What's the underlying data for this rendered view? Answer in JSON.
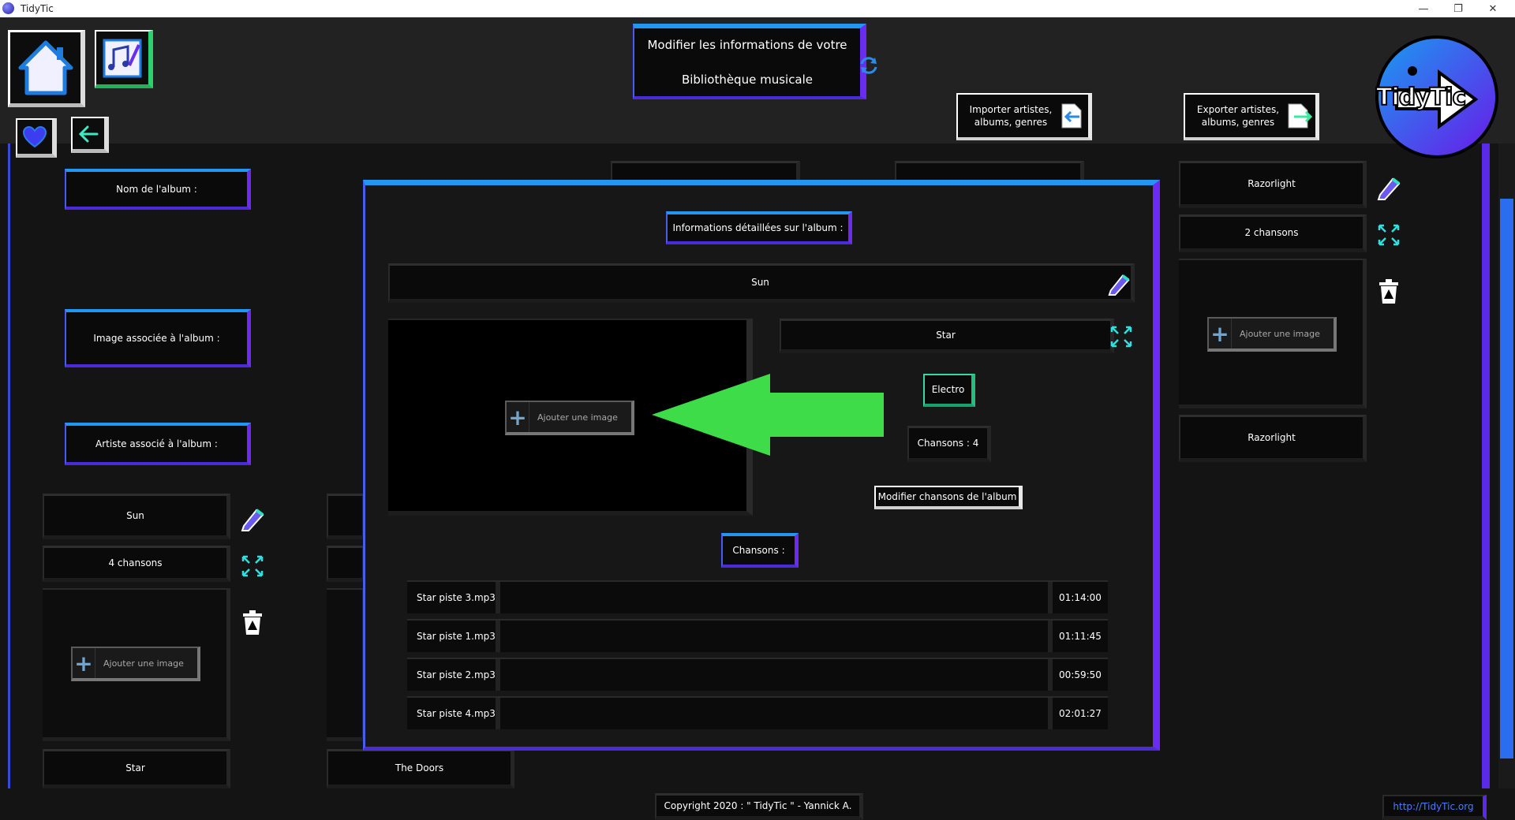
{
  "window": {
    "title": "TidyTic"
  },
  "header": {
    "title_line1": "Modifier les informations de votre",
    "title_line2": "Bibliothèque musicale",
    "import_label": "Importer artistes, albums, genres",
    "export_label": "Exporter artistes, albums, genres",
    "logo_text": "TidyTic"
  },
  "left_panel": {
    "album_name_label": "Nom de l'album :",
    "album_image_label": "Image associée à l'album :",
    "album_artist_label": "Artiste associé à l'album :",
    "card1_name": "Sun",
    "card1_count": "4 chansons",
    "card1_add_image": "Ajouter une image",
    "card1_artist": "Star",
    "card2_artist": "The Doors"
  },
  "right_panel": {
    "name": "Razorlight",
    "count": "2 chansons",
    "add_image": "Ajouter une image",
    "artist": "Razorlight"
  },
  "modal": {
    "heading": "Informations détaillées sur l'album :",
    "album_name": "Sun",
    "add_image": "Ajouter une image",
    "artist": "Star",
    "genre": "Electro",
    "songs_count": "Chansons  : 4",
    "edit_songs_button": "Modifier chansons de l'album",
    "songs_heading": "Chansons  :",
    "songs": [
      {
        "name": "Star piste 3.mp3",
        "duration": "01:14:00"
      },
      {
        "name": "Star piste 1.mp3",
        "duration": "01:11:45"
      },
      {
        "name": "Star piste 2.mp3",
        "duration": "00:59:50"
      },
      {
        "name": "Star piste 4.mp3",
        "duration": "02:01:27"
      }
    ]
  },
  "footer": {
    "copyright": "Copyright 2020 : \" TidyTic \" - Yannick A.",
    "website": "http://TidyTic.org"
  },
  "colors": {
    "accent_blue": "#2196f3",
    "accent_purple": "#6a2cf0",
    "arrow_green": "#3ddc48"
  }
}
